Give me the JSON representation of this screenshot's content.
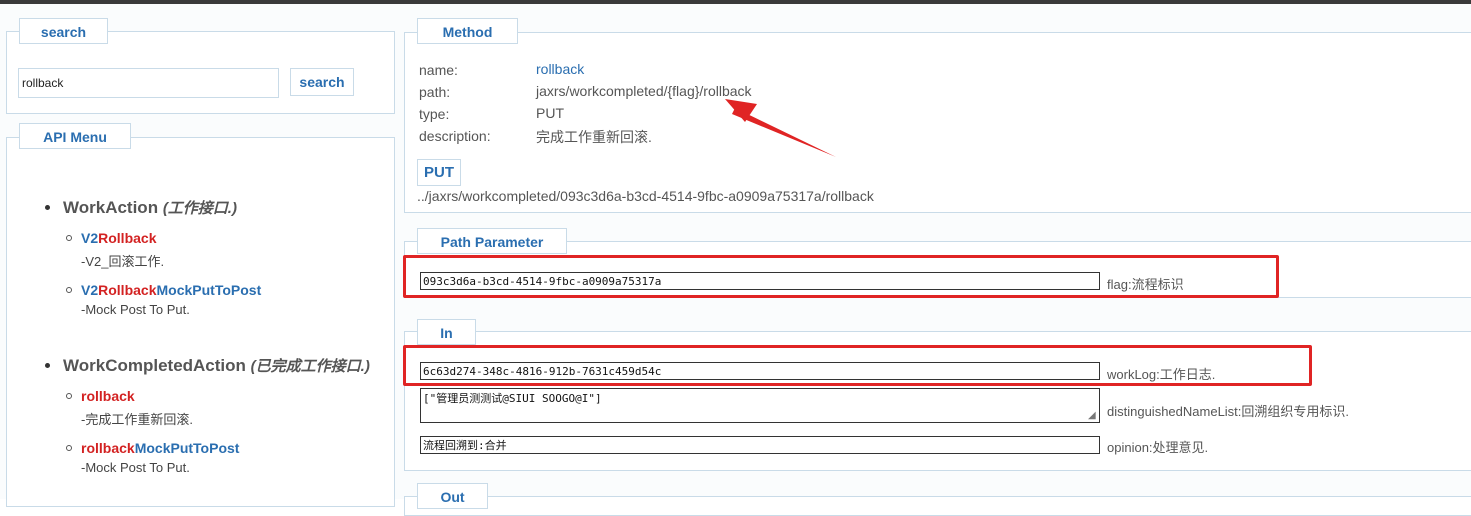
{
  "search": {
    "legend": "search",
    "value": "rollback",
    "button_label": "search"
  },
  "menu": {
    "legend": "API Menu",
    "groups": [
      {
        "name": "WorkAction",
        "desc": "(工作接口.)",
        "items": [
          {
            "title_prefix": "V2",
            "title_match": "Rollback",
            "title_suffix": "",
            "desc": "-V2_回滚工作."
          },
          {
            "title_prefix": "V2",
            "title_match": "Rollback",
            "title_suffix": "MockPutToPost",
            "desc": "-Mock Post To Put."
          }
        ]
      },
      {
        "name": "WorkCompletedAction",
        "desc": "(已完成工作接口.)",
        "items": [
          {
            "title_prefix": "",
            "title_match": "rollback",
            "title_suffix": "",
            "desc": "-完成工作重新回滚."
          },
          {
            "title_prefix": "",
            "title_match": "rollback",
            "title_suffix": "MockPutToPost",
            "desc": "-Mock Post To Put."
          }
        ]
      }
    ]
  },
  "method": {
    "legend": "Method",
    "name_label": "name:",
    "name_value": "rollback",
    "path_label": "path:",
    "path_value": "jaxrs/workcompleted/{flag}/rollback",
    "type_label": "type:",
    "type_value": "PUT",
    "description_label": "description:",
    "description_value": "完成工作重新回滚.",
    "button_label": "PUT",
    "url": "../jaxrs/workcompleted/093c3d6a-b3cd-4514-9fbc-a0909a75317a/rollback"
  },
  "path_parameter": {
    "legend": "Path Parameter",
    "params": [
      {
        "value": "093c3d6a-b3cd-4514-9fbc-a0909a75317a",
        "label": "flag:流程标识"
      }
    ]
  },
  "in": {
    "legend": "In",
    "worklog_value": "6c63d274-348c-4816-912b-7631c459d54c",
    "worklog_label": "workLog:工作日志.",
    "dn_value": "[\"管理员测测试@SIUI SOOGO@I\"]",
    "dn_label": "distinguishedNameList:回溯组织专用标识.",
    "opinion_value": "流程回溯到:合并",
    "opinion_label": "opinion:处理意见."
  },
  "out": {
    "legend": "Out"
  },
  "colors": {
    "accent": "#2a6eb0",
    "highlight": "#d32222",
    "annotation": "#e02424",
    "border": "#c9dbe8"
  }
}
